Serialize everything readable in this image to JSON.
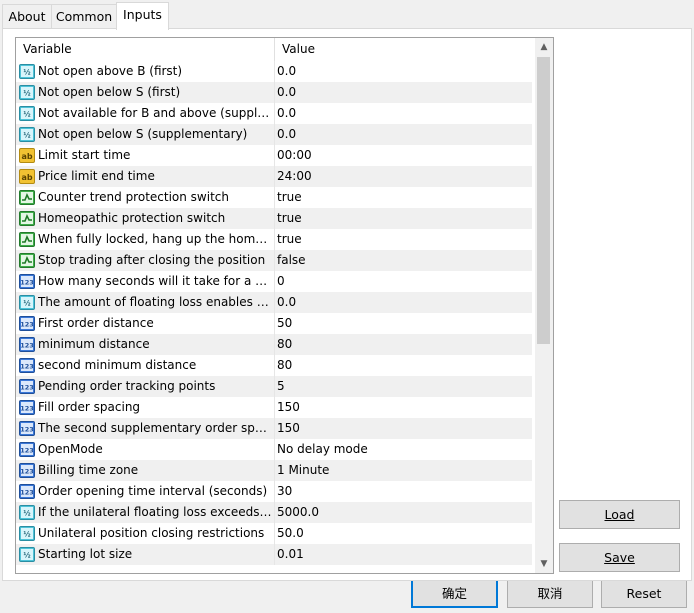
{
  "tabs": [
    {
      "label": "About"
    },
    {
      "label": "Common"
    },
    {
      "label": "Inputs"
    }
  ],
  "table": {
    "headers": [
      "Variable",
      "Value"
    ],
    "rows": [
      {
        "icon": "double-type-icon",
        "name": "Not open above B (first)",
        "value": "0.0"
      },
      {
        "icon": "double-type-icon",
        "name": "Not open below S (first)",
        "value": "0.0"
      },
      {
        "icon": "double-type-icon",
        "name": "Not available for B and above (supplementary)",
        "value": "0.0"
      },
      {
        "icon": "double-type-icon",
        "name": "Not open below S (supplementary)",
        "value": "0.0"
      },
      {
        "icon": "string-type-icon",
        "name": "Limit start time",
        "value": "00:00"
      },
      {
        "icon": "string-type-icon",
        "name": "Price limit end time",
        "value": "24:00"
      },
      {
        "icon": "bool-type-icon",
        "name": "Counter trend protection switch",
        "value": "true"
      },
      {
        "icon": "bool-type-icon",
        "name": "Homeopathic protection switch",
        "value": "true"
      },
      {
        "icon": "bool-type-icon",
        "name": "When fully locked, hang up the homeopathic order",
        "value": "true"
      },
      {
        "icon": "bool-type-icon",
        "name": "Stop trading after closing the position",
        "value": "false"
      },
      {
        "icon": "int-type-icon",
        "name": "How many seconds will it take for a new order",
        "value": "0"
      },
      {
        "icon": "double-type-icon",
        "name": "The amount of floating loss enables the protection",
        "value": "0.0"
      },
      {
        "icon": "int-type-icon",
        "name": "First order distance",
        "value": "50"
      },
      {
        "icon": "int-type-icon",
        "name": "minimum distance",
        "value": "80"
      },
      {
        "icon": "int-type-icon",
        "name": "second minimum distance",
        "value": "80"
      },
      {
        "icon": "int-type-icon",
        "name": "Pending order tracking points",
        "value": "5"
      },
      {
        "icon": "int-type-icon",
        "name": "Fill order spacing",
        "value": "150"
      },
      {
        "icon": "int-type-icon",
        "name": "The second supplementary order spacing",
        "value": "150"
      },
      {
        "icon": "enum-type-icon",
        "name": "OpenMode",
        "value": "No delay mode"
      },
      {
        "icon": "enum-type-icon",
        "name": "Billing time zone",
        "value": "1 Minute"
      },
      {
        "icon": "int-type-icon",
        "name": "Order opening time interval (seconds)",
        "value": "30"
      },
      {
        "icon": "double-type-icon",
        "name": "If the unilateral floating loss exceeds the amount",
        "value": "5000.0"
      },
      {
        "icon": "double-type-icon",
        "name": "Unilateral position closing restrictions",
        "value": "50.0"
      },
      {
        "icon": "double-type-icon",
        "name": "Starting lot size",
        "value": "0.01"
      }
    ]
  },
  "side_buttons": {
    "load": "Load",
    "save": "Save"
  },
  "footer_buttons": {
    "ok": "确定",
    "cancel": "取消",
    "reset": "Reset"
  },
  "colors": {
    "row_alt": "#f0f0f0",
    "accent": "#0078d7"
  }
}
